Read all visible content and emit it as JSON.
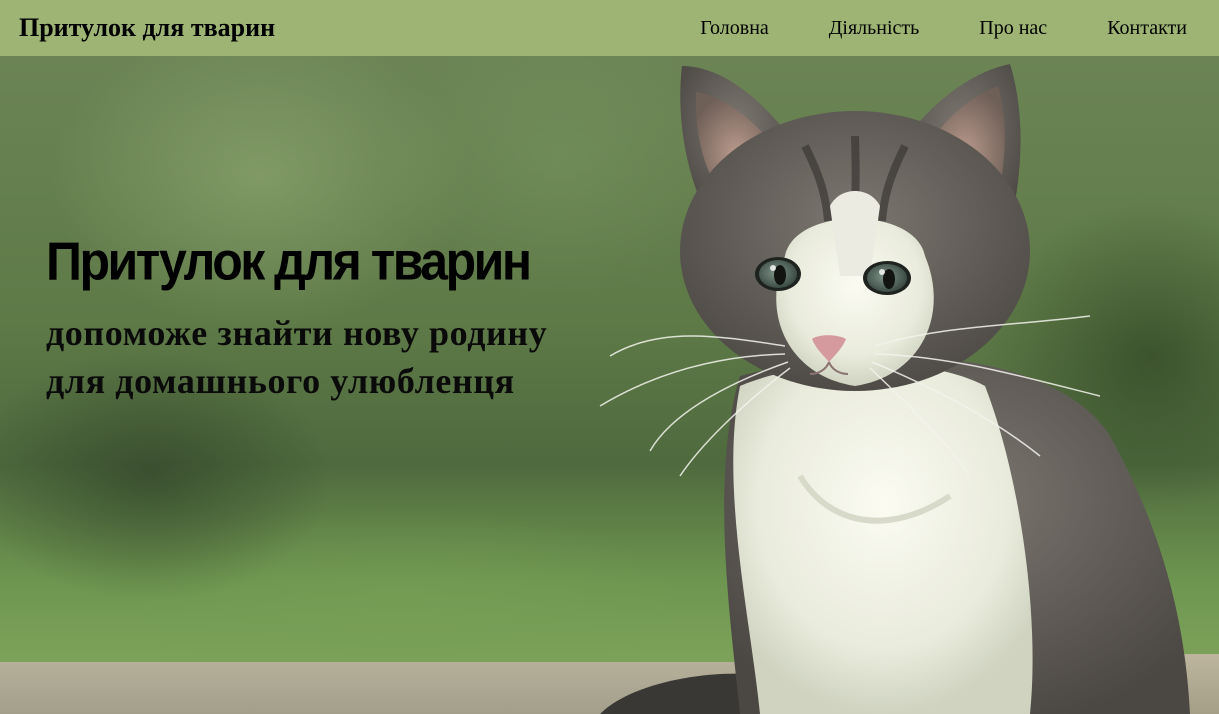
{
  "header": {
    "brand": "Притулок для тварин",
    "nav": [
      {
        "label": "Головна"
      },
      {
        "label": "Діяльність"
      },
      {
        "label": "Про нас"
      },
      {
        "label": "Контакти"
      }
    ]
  },
  "hero": {
    "title": "Притулок для тварин",
    "subtitle_line1": "допоможе знайти нову родину",
    "subtitle_line2": "для домашнього улюбленця",
    "image": "kitten-photo"
  },
  "colors": {
    "navbar_bg": "#9db474",
    "text": "#000000"
  }
}
